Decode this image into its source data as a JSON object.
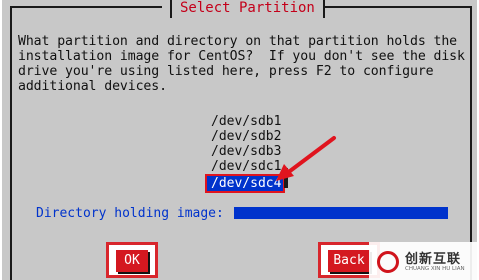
{
  "dialog": {
    "title": "Select Partition",
    "description_lines": [
      "What partition and directory on that partition holds the",
      "installation image for CentOS?  If you don't see the disk",
      "drive you're using listed here, press F2 to configure",
      "additional devices."
    ]
  },
  "devices": [
    {
      "label": "/dev/sdb1",
      "selected": false
    },
    {
      "label": "/dev/sdb2",
      "selected": false
    },
    {
      "label": "/dev/sdb3",
      "selected": false
    },
    {
      "label": "/dev/sdc1",
      "selected": false
    },
    {
      "label": "/dev/sdc4",
      "selected": true
    }
  ],
  "directory": {
    "label": "Directory holding image:",
    "value": ""
  },
  "buttons": {
    "ok_label": "OK",
    "back_label": "Back"
  },
  "annotation": {
    "arrow_color": "#e0141e"
  },
  "watermark": {
    "text": "创新互联",
    "subtext": "CHUANG XIN HU LIAN"
  },
  "colors": {
    "title": "#c4001a",
    "highlight": "#0033cc",
    "button": "#d41820"
  }
}
